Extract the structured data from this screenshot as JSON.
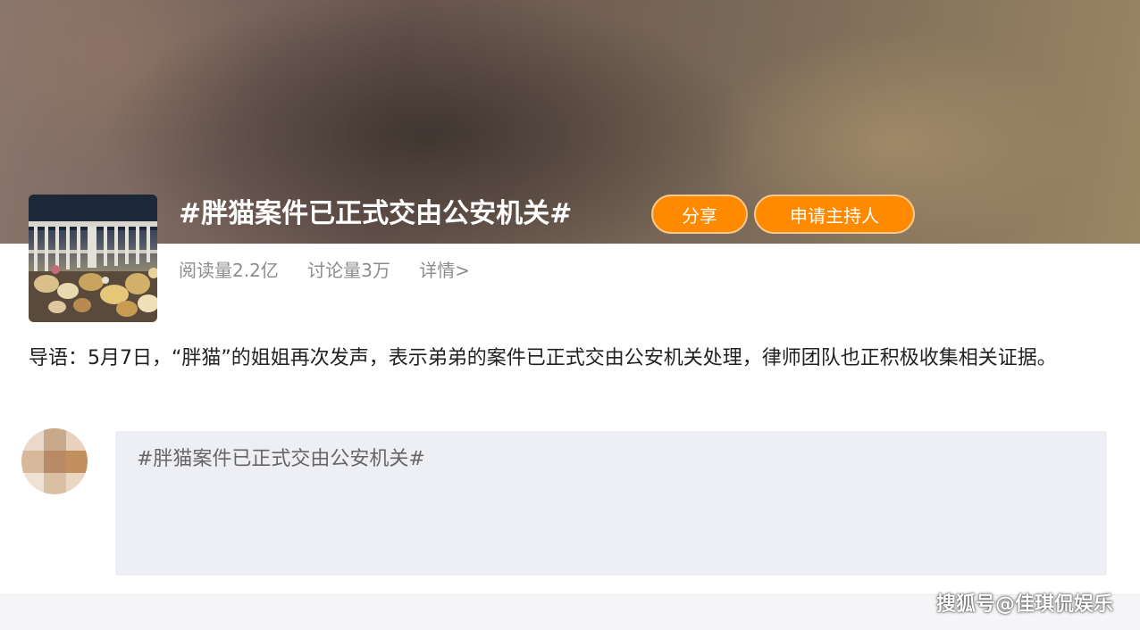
{
  "topic": {
    "title": "#胖猫案件已正式交由公安机关#",
    "share_label": "分享",
    "apply_host_label": "申请主持人",
    "accent_color": "#ff8a00"
  },
  "stats": {
    "reads": "阅读量2.2亿",
    "discussions": "讨论量3万",
    "details_link": "详情>"
  },
  "intro": {
    "text": "导语：5月7日，“胖猫”的姐姐再次发声，表示弟弟的案件已正式交由公安机关处理，律师团队也正积极收集相关证据。"
  },
  "composer": {
    "prefill": "#胖猫案件已正式交由公安机关#"
  },
  "watermark": {
    "text": "搜狐号@佳琪侃娱乐"
  }
}
